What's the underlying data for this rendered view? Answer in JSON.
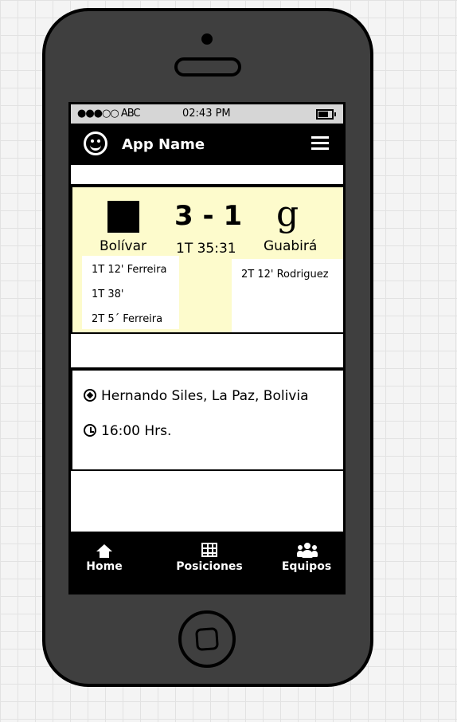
{
  "status": {
    "signal": "●●●○○ ABC",
    "time": "02:43 PM"
  },
  "nav": {
    "title": "App Name"
  },
  "match": {
    "team_a": "Bolívar",
    "team_b": "Guabirá",
    "team_b_logo": "g",
    "score": "3 - 1",
    "time": "1T 35:31",
    "goals_a": [
      "1T 12' Ferreira",
      "1T 38'",
      "2T 5´ Ferreira"
    ],
    "goals_b": [
      "2T 12' Rodriguez"
    ]
  },
  "info": {
    "venue": "Hernando Siles, La Paz, Bolivia",
    "kickoff": "16:00 Hrs."
  },
  "tabs": [
    {
      "label": "Home",
      "icon": "home-icon"
    },
    {
      "label": "Posiciones",
      "icon": "grid-icon"
    },
    {
      "label": "Equipos",
      "icon": "people-icon"
    }
  ],
  "colors": {
    "highlight": "#fdfbcc",
    "bar": "#000000",
    "phone": "#3f3f3f"
  }
}
